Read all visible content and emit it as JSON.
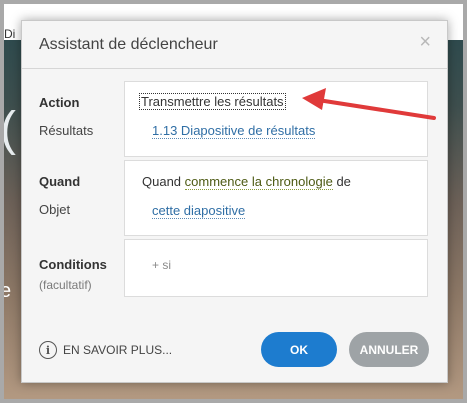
{
  "background": {
    "topbar_fragment": "Di"
  },
  "dialog": {
    "title": "Assistant de déclencheur",
    "close_glyph": "×",
    "action": {
      "label": "Action",
      "value": "Transmettre les résultats",
      "sub_label": "Résultats",
      "sub_value": "1.13 Diapositive de résultats"
    },
    "when": {
      "label": "Quand",
      "prefix": "Quand",
      "event": "commence la chronologie",
      "suffix": "de",
      "object_label": "Objet",
      "object_value": "cette diapositive"
    },
    "conditions": {
      "label": "Conditions",
      "hint": "(facultatif)",
      "add": "+ si"
    },
    "footer": {
      "learn_more": "EN SAVOIR PLUS...",
      "info_icon": "i",
      "ok": "OK",
      "cancel": "ANNULER"
    }
  },
  "colors": {
    "ok_button": "#1d7ccf",
    "cancel_button": "#9ea3a6",
    "annotation_arrow": "#e03a3a",
    "link": "#2f6ea5"
  }
}
